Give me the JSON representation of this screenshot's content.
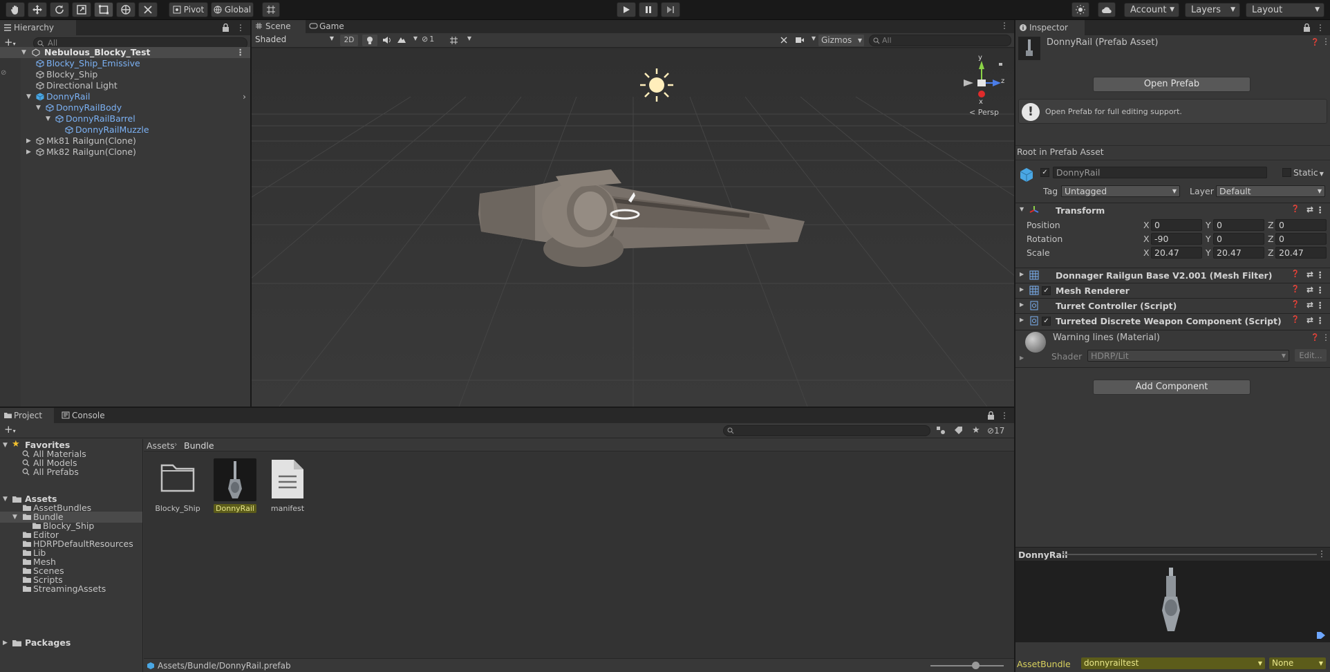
{
  "toolbar": {
    "pivot_label": "Pivot",
    "global_label": "Global",
    "account_label": "Account",
    "layers_label": "Layers",
    "layout_label": "Layout"
  },
  "hierarchy": {
    "tab_label": "Hierarchy",
    "search_placeholder": "All",
    "scene_name": "Nebulous_Blocky_Test",
    "items": [
      {
        "label": "Blocky_Ship_Emissive"
      },
      {
        "label": "Blocky_Ship"
      },
      {
        "label": "Directional Light"
      },
      {
        "label": "DonnyRail"
      },
      {
        "label": "DonnyRailBody"
      },
      {
        "label": "DonnyRailBarrel"
      },
      {
        "label": "DonnyRailMuzzle"
      },
      {
        "label": "Mk81 Railgun(Clone)"
      },
      {
        "label": "Mk82 Railgun(Clone)"
      }
    ]
  },
  "scene": {
    "tab_scene": "Scene",
    "tab_game": "Game",
    "shading_mode": "Shaded",
    "mode_2d": "2D",
    "hidden_count": "1",
    "gizmos_label": "Gizmos",
    "search_placeholder": "All",
    "gizmo_axes": {
      "y": "y",
      "z": "z",
      "x": "x"
    },
    "persp_label": "Persp"
  },
  "inspector": {
    "tab_label": "Inspector",
    "asset_title": "DonnyRail (Prefab Asset)",
    "open_prefab_label": "Open Prefab",
    "info_text": "Open Prefab for full editing support.",
    "root_label": "Root in Prefab Asset",
    "object_name": "DonnyRail",
    "static_label": "Static",
    "tag_label": "Tag",
    "tag_value": "Untagged",
    "layer_label": "Layer",
    "layer_value": "Default",
    "transform_title": "Transform",
    "position_label": "Position",
    "rotation_label": "Rotation",
    "scale_label": "Scale",
    "axis_x": "X",
    "axis_y": "Y",
    "axis_z": "Z",
    "position": {
      "x": "0",
      "y": "0",
      "z": "0"
    },
    "rotation": {
      "x": "-90",
      "y": "0",
      "z": "0"
    },
    "scale": {
      "x": "20.47",
      "y": "20.47",
      "z": "20.47"
    },
    "components": [
      {
        "label": "Donnager Railgun Base V2.001 (Mesh Filter)"
      },
      {
        "label": "Mesh Renderer"
      },
      {
        "label": "Turret Controller (Script)"
      },
      {
        "label": "Turreted Discrete Weapon Component (Script)"
      }
    ],
    "material_name": "Warning lines (Material)",
    "shader_label": "Shader",
    "shader_value": "HDRP/Lit",
    "edit_label": "Edit...",
    "add_component_label": "Add Component",
    "preview_title": "DonnyRail",
    "assetbundle_label": "AssetBundle",
    "assetbundle_value": "donnyrailtest",
    "variant_value": "None"
  },
  "project": {
    "tab_project": "Project",
    "tab_console": "Console",
    "hidden_count": "17",
    "favorites_label": "Favorites",
    "favorites": [
      "All Materials",
      "All Models",
      "All Prefabs"
    ],
    "assets_label": "Assets",
    "asset_folders": [
      "AssetBundles",
      "Bundle",
      "Blocky_Ship",
      "Editor",
      "HDRPDefaultResources",
      "Lib",
      "Mesh",
      "Scenes",
      "Scripts",
      "StreamingAssets"
    ],
    "packages_label": "Packages",
    "breadcrumb": [
      "Assets",
      "Bundle"
    ],
    "files": [
      {
        "label": "Blocky_Ship"
      },
      {
        "label": "DonnyRail"
      },
      {
        "label": "manifest"
      }
    ],
    "status_path": "Assets/Bundle/DonnyRail.prefab"
  },
  "colors": {
    "accent_blue": "#7cb2f5",
    "selected_bundle": "#5c5c1a",
    "play_bg": "#3a3a3a"
  }
}
